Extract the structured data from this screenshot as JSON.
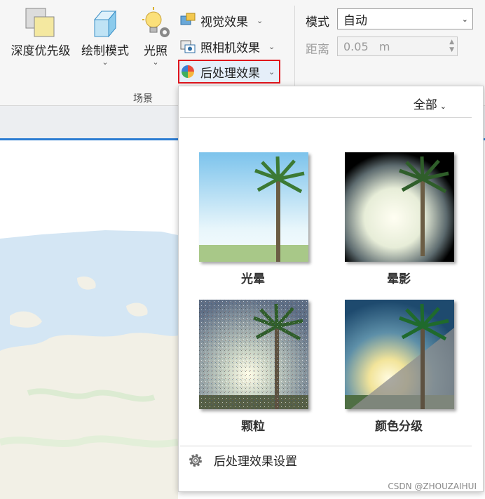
{
  "ribbon": {
    "depth_priority_label": "深度优先级",
    "draw_mode_label": "绘制模式",
    "lighting_label": "光照",
    "visual_effects_label": "视觉效果",
    "camera_effects_label": "照相机效果",
    "post_processing_label": "后处理效果",
    "group_label": "场景",
    "mode_label": "模式",
    "mode_value": "自动",
    "distance_label": "距离",
    "distance_value": "0.05   m"
  },
  "popup": {
    "filter_label": "全部",
    "effects": [
      {
        "name": "光晕"
      },
      {
        "name": "晕影"
      },
      {
        "name": "颗粒"
      },
      {
        "name": "颜色分级"
      }
    ],
    "settings_label": "后处理效果设置"
  },
  "watermark": "CSDN @ZHOUZAIHUI",
  "colors": {
    "highlight_border": "#e0141c",
    "accent_blue": "#2a7bd2",
    "map_land": "#f2f0e6",
    "map_water": "#d4e6f4"
  },
  "icons": [
    "depth-priority-icon",
    "draw-mode-icon",
    "lighting-icon",
    "visual-effects-icon",
    "camera-effects-icon",
    "post-processing-icon",
    "gear-icon"
  ]
}
